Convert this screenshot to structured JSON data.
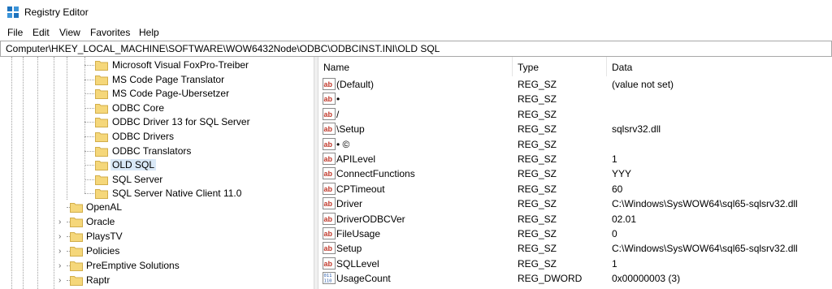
{
  "window": {
    "title": "Registry Editor",
    "app_icon": "registry-editor-icon"
  },
  "menu": [
    "File",
    "Edit",
    "View",
    "Favorites",
    "Help"
  ],
  "address": {
    "path": "Computer\\HKEY_LOCAL_MACHINE\\SOFTWARE\\WOW6432Node\\ODBC\\ODBCINST.INI\\OLD SQL"
  },
  "tree": {
    "children_of_odbcinst": [
      "Microsoft Visual FoxPro-Treiber",
      "MS Code Page Translator",
      "MS Code Page-Ubersetzer",
      "ODBC Core",
      "ODBC Driver 13 for SQL Server",
      "ODBC Drivers",
      "ODBC Translators",
      "OLD SQL",
      "SQL Server",
      "SQL Server Native Client 11.0"
    ],
    "selected": "OLD SQL",
    "software_keys": [
      "OpenAL",
      "Oracle",
      "PlaysTV",
      "Policies",
      "PreEmptive Solutions",
      "Raptr"
    ]
  },
  "values_list": {
    "headers": {
      "name": "Name",
      "type": "Type",
      "data": "Data"
    },
    "rows": [
      {
        "name": "(Default)",
        "type": "REG_SZ",
        "data": "(value not set)",
        "icon": "string-value-icon"
      },
      {
        "name": "•",
        "type": "REG_SZ",
        "data": "",
        "icon": "string-value-icon"
      },
      {
        "name": "/",
        "type": "REG_SZ",
        "data": "",
        "icon": "string-value-icon"
      },
      {
        "name": "\\Setup",
        "type": "REG_SZ",
        "data": "sqlsrv32.dll",
        "icon": "string-value-icon"
      },
      {
        "name": "• ©",
        "type": "REG_SZ",
        "data": "",
        "icon": "string-value-icon"
      },
      {
        "name": "APILevel",
        "type": "REG_SZ",
        "data": "1",
        "icon": "string-value-icon"
      },
      {
        "name": "ConnectFunctions",
        "type": "REG_SZ",
        "data": "YYY",
        "icon": "string-value-icon"
      },
      {
        "name": "CPTimeout",
        "type": "REG_SZ",
        "data": "60",
        "icon": "string-value-icon"
      },
      {
        "name": "Driver",
        "type": "REG_SZ",
        "data": "C:\\Windows\\SysWOW64\\sql65-sqlsrv32.dll",
        "icon": "string-value-icon"
      },
      {
        "name": "DriverODBCVer",
        "type": "REG_SZ",
        "data": "02.01",
        "icon": "string-value-icon"
      },
      {
        "name": "FileUsage",
        "type": "REG_SZ",
        "data": "0",
        "icon": "string-value-icon"
      },
      {
        "name": "Setup",
        "type": "REG_SZ",
        "data": "C:\\Windows\\SysWOW64\\sql65-sqlsrv32.dll",
        "icon": "string-value-icon"
      },
      {
        "name": "SQLLevel",
        "type": "REG_SZ",
        "data": "1",
        "icon": "string-value-icon"
      },
      {
        "name": "UsageCount",
        "type": "REG_DWORD",
        "data": "0x00000003 (3)",
        "icon": "binary-value-icon"
      }
    ]
  },
  "colors": {
    "folder": "#f5d77a",
    "selection": "#d9e8f7",
    "string_icon_red": "#c0392b",
    "dword_icon_blue": "#2a5caa"
  }
}
